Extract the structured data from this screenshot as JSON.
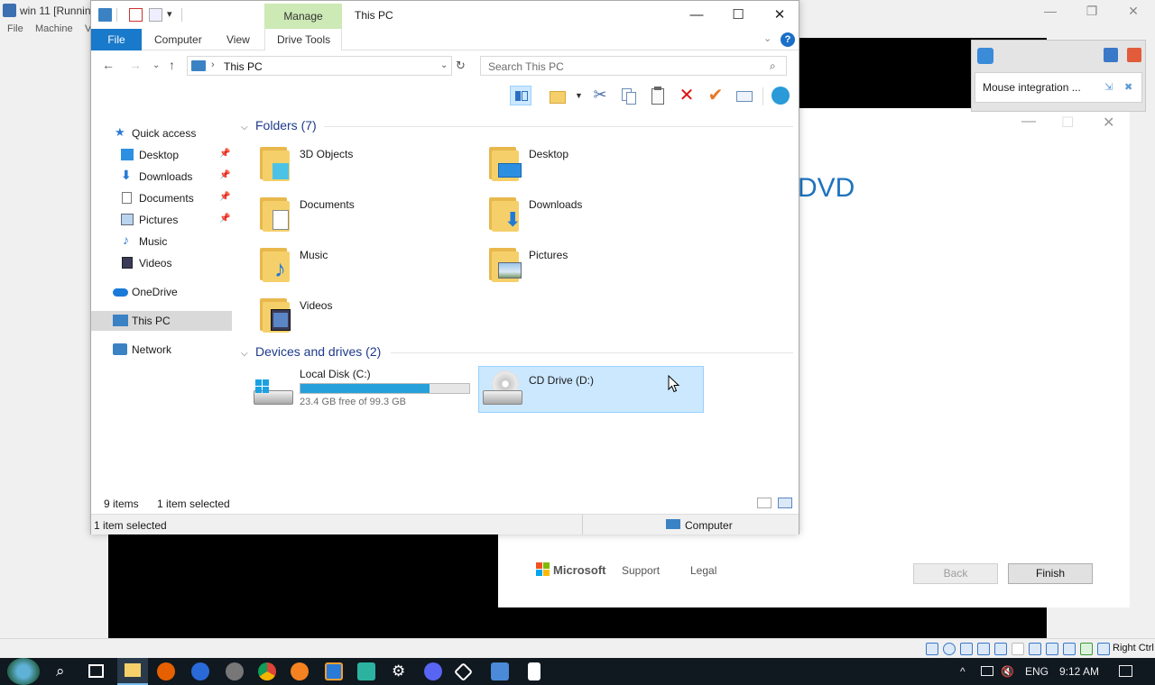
{
  "host": {
    "title": "win 11 [Runnin",
    "menu": [
      "File",
      "Machine",
      "V"
    ],
    "host_key": "Right Ctrl"
  },
  "vb_popup": {
    "message": "Mouse integration ..."
  },
  "setup": {
    "heading": "DVD",
    "brand": "Microsoft",
    "support": "Support",
    "legal": "Legal",
    "back": "Back",
    "finish": "Finish"
  },
  "explorer": {
    "title": "This PC",
    "manage_tab": "Manage",
    "tabs": {
      "file": "File",
      "computer": "Computer",
      "view": "View",
      "drive_tools": "Drive Tools"
    },
    "address": "This PC",
    "search_placeholder": "Search This PC",
    "nav": {
      "quick_access": "Quick access",
      "desktop": "Desktop",
      "downloads": "Downloads",
      "documents": "Documents",
      "pictures": "Pictures",
      "music": "Music",
      "videos": "Videos",
      "onedrive": "OneDrive",
      "this_pc": "This PC",
      "network": "Network"
    },
    "folders_header": "Folders (7)",
    "folders": [
      "3D Objects",
      "Desktop",
      "Documents",
      "Downloads",
      "Music",
      "Pictures",
      "Videos"
    ],
    "drives_header": "Devices and drives (2)",
    "drives": [
      {
        "name": "Local Disk (C:)",
        "free": "23.4 GB free of 99.3 GB",
        "used_fraction": 0.764
      },
      {
        "name": "CD Drive (D:)"
      }
    ],
    "status": {
      "items": "9 items",
      "selected": "1 item selected",
      "bottom_selected": "1 item selected",
      "zone": "Computer"
    }
  },
  "taskbar": {
    "language": "ENG",
    "time": "9:12 AM"
  }
}
